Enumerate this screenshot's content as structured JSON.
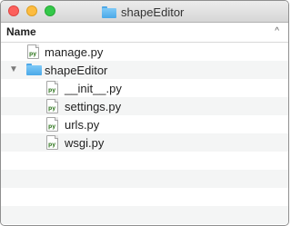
{
  "window": {
    "title": "shapeEditor"
  },
  "header": {
    "column_label": "Name",
    "sort_indicator": "^"
  },
  "tree": [
    {
      "name": "manage.py",
      "kind": "file",
      "icon": "python-file-icon"
    },
    {
      "name": "shapeEditor",
      "kind": "folder",
      "icon": "folder-icon",
      "expanded": true
    },
    {
      "name": "__init__.py",
      "kind": "file",
      "icon": "python-file-icon"
    },
    {
      "name": "settings.py",
      "kind": "file",
      "icon": "python-file-icon"
    },
    {
      "name": "urls.py",
      "kind": "file",
      "icon": "python-file-icon"
    },
    {
      "name": "wsgi.py",
      "kind": "file",
      "icon": "python-file-icon"
    }
  ],
  "icons": {
    "disclosure_open": "▼",
    "file_badge": "py"
  },
  "colors": {
    "close": "#fc605c",
    "minimize": "#fdbc40",
    "maximize": "#34c84a",
    "folder": "#5ab2ee",
    "row_alt": "#f4f5f5"
  }
}
